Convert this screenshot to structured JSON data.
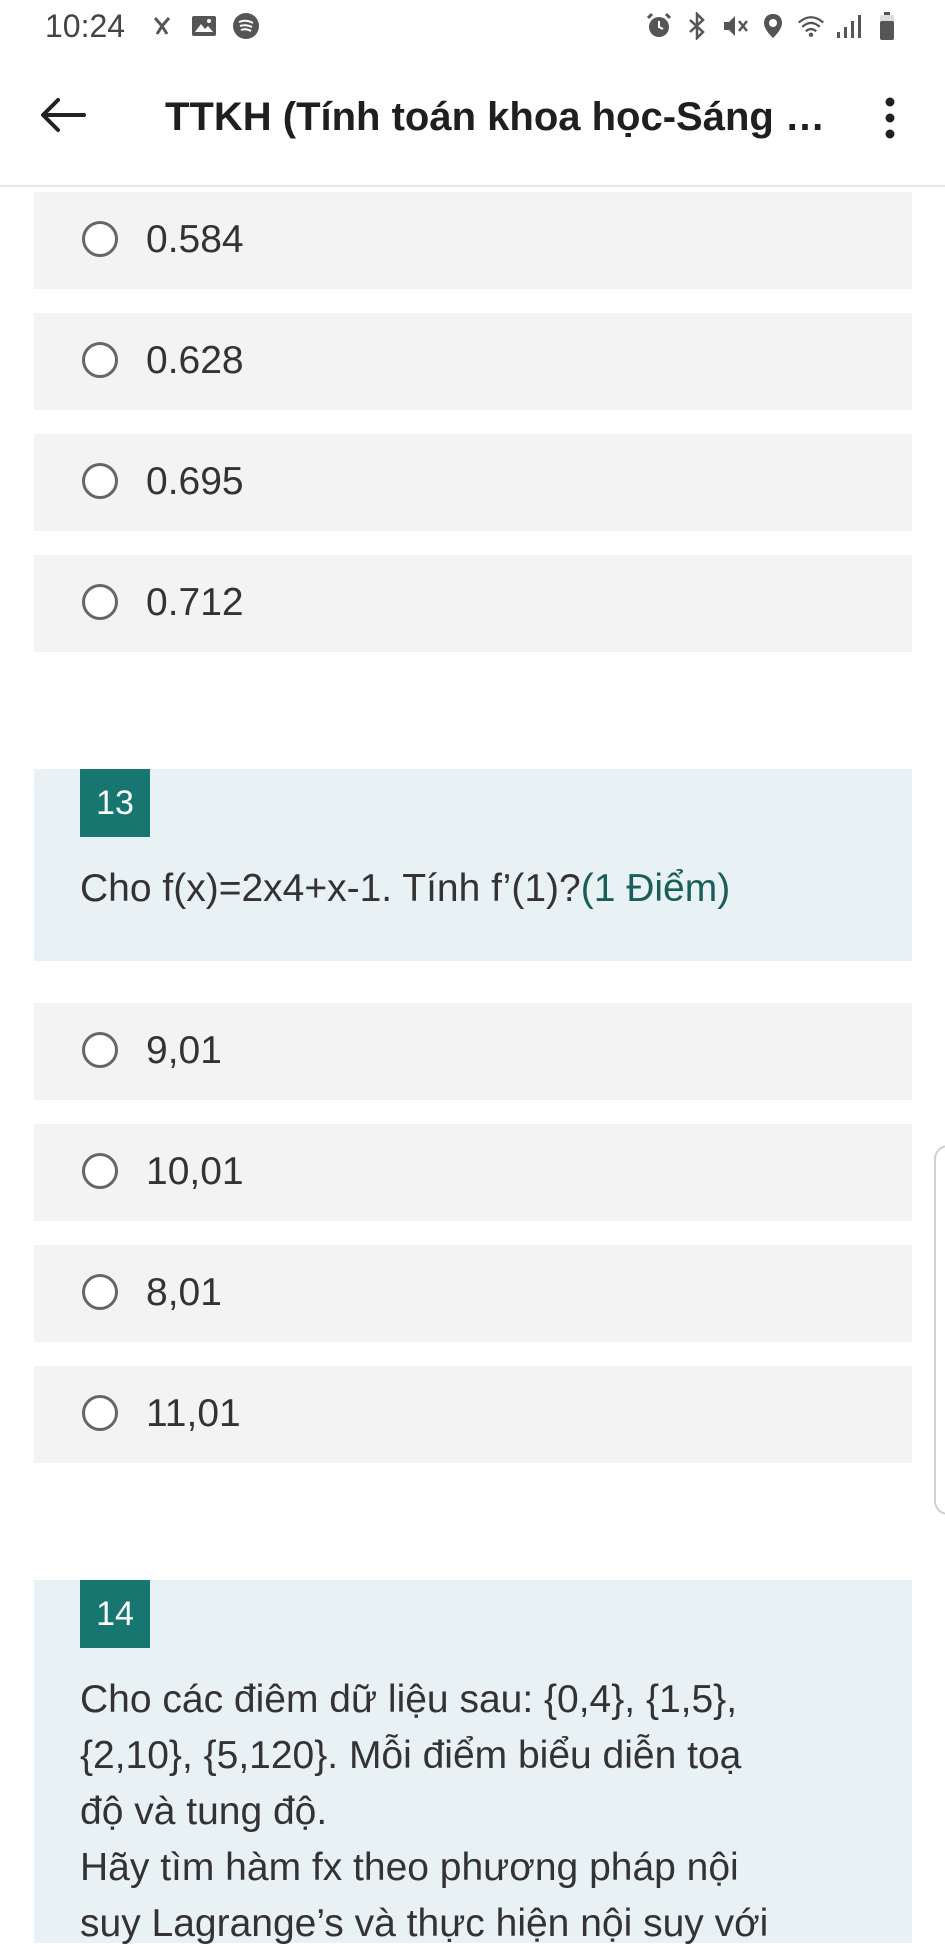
{
  "status": {
    "time": "10:24",
    "left_icons": [
      "notification-icon",
      "gallery-icon",
      "spotify-icon"
    ],
    "right_icons": [
      "alarm-icon",
      "bluetooth-icon",
      "mute-icon",
      "location-icon",
      "wifi-icon",
      "signal-icon",
      "battery-icon"
    ]
  },
  "app_bar": {
    "title": "TTKH (Tính toán khoa học-Sáng th..."
  },
  "question_12": {
    "options": [
      "0.584",
      "0.628",
      "0.695",
      "0.712"
    ]
  },
  "question_13": {
    "number": "13",
    "text": "Cho f(x)=2x4+x-1. Tính f’(1)?",
    "points": "(1 Điểm)",
    "options": [
      "9,01",
      "10,01",
      "8,01",
      "11,01"
    ]
  },
  "question_14": {
    "number": "14",
    "line1": "Cho các điêm dữ liệu sau: {0,4}, {1,5},",
    "line2": "{2,10}, {5,120}. Mỗi điểm biểu diễn toạ",
    "line3": "độ và tung độ.",
    "line4": "Hãy tìm hàm fx theo phương pháp nội",
    "line5": "suy Lagrange’s và thực hiện nội suy với"
  },
  "colors": {
    "accent": "#17766f",
    "card_bg": "#e8f1f3",
    "option_bg": "#f3f3f3"
  }
}
